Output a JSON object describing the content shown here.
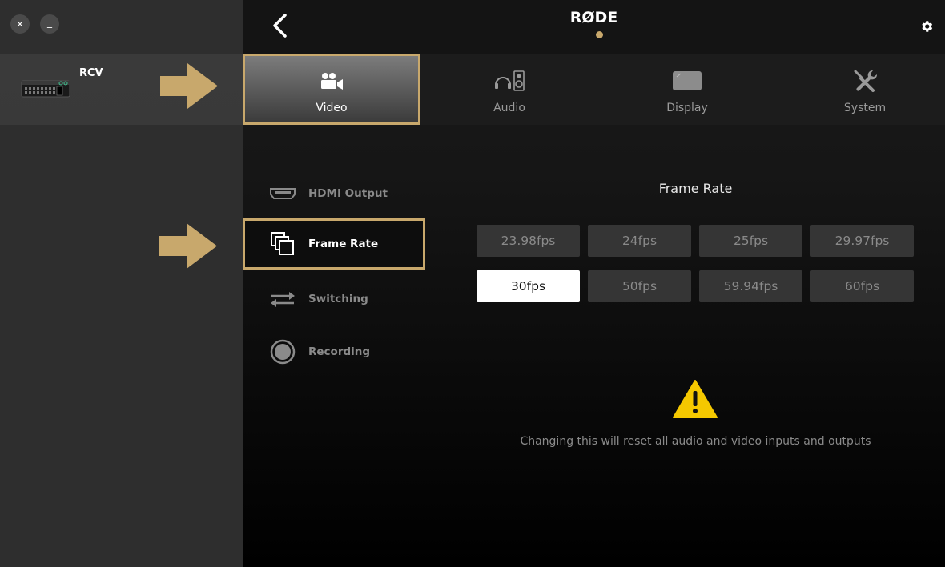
{
  "window": {
    "close_label": "✕",
    "minimize_label": "_"
  },
  "sidebar": {
    "device": {
      "label": "RCV"
    }
  },
  "header": {
    "logo": "RØDE"
  },
  "tabs": [
    {
      "label": "Video",
      "icon": "video-camera-icon",
      "active": true
    },
    {
      "label": "Audio",
      "icon": "headphones-speaker-icon",
      "active": false
    },
    {
      "label": "Display",
      "icon": "display-icon",
      "active": false
    },
    {
      "label": "System",
      "icon": "tools-icon",
      "active": false
    }
  ],
  "submenu": [
    {
      "label": "HDMI Output",
      "icon": "hdmi-icon",
      "active": false
    },
    {
      "label": "Frame Rate",
      "icon": "frame-rate-icon",
      "active": true
    },
    {
      "label": "Switching",
      "icon": "switching-icon",
      "active": false
    },
    {
      "label": "Recording",
      "icon": "record-icon",
      "active": false
    }
  ],
  "frame_rate": {
    "title": "Frame Rate",
    "options": [
      "23.98fps",
      "24fps",
      "25fps",
      "29.97fps",
      "30fps",
      "50fps",
      "59.94fps",
      "60fps"
    ],
    "selected": "30fps"
  },
  "warning": {
    "text": "Changing this will reset all audio and video inputs and outputs"
  },
  "colors": {
    "accent": "#c8a86c",
    "warning": "#f5c800"
  }
}
